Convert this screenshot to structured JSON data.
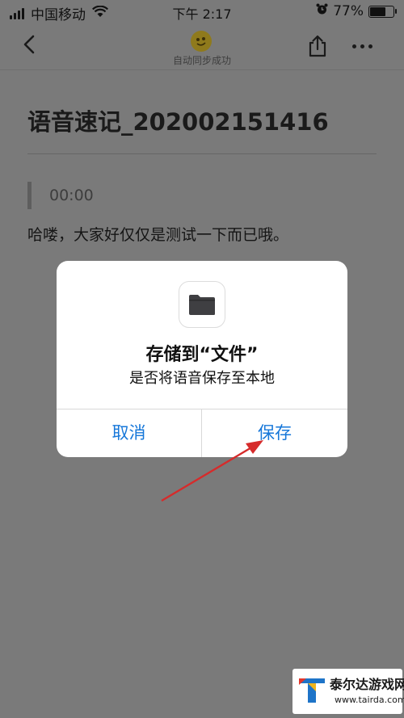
{
  "status_bar": {
    "carrier": "中国移动",
    "time": "下午 2:17",
    "battery_percent": "77%",
    "battery_level": 0.77,
    "icons": [
      "signal-icon",
      "wifi-icon",
      "alarm-icon",
      "battery-icon"
    ]
  },
  "nav": {
    "sync_status": "自动同步成功",
    "icons": [
      "back-icon",
      "app-logo-icon",
      "share-icon",
      "more-icon"
    ]
  },
  "note": {
    "title": "语音速记_202002151416",
    "audio_time": "00:00",
    "body": "哈喽，大家好仅仅是测试一下而已哦。"
  },
  "dialog": {
    "title": "存储到“文件”",
    "message": "是否将语音保存至本地",
    "cancel_label": "取消",
    "save_label": "保存",
    "icon": "folder-icon",
    "accent_color": "#1677d9"
  },
  "annotation": {
    "color": "#d62b2b"
  },
  "watermark": {
    "name": "泰尔达游戏网",
    "url": "www.tairda.com"
  }
}
